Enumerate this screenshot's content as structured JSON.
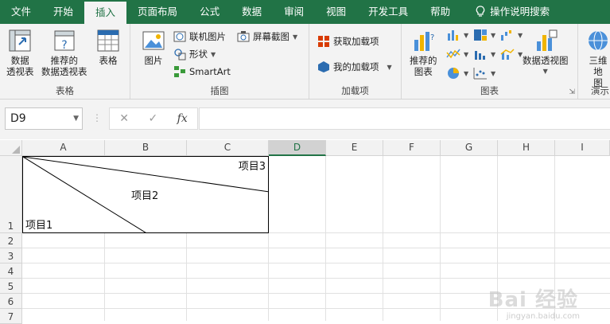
{
  "ribbon_tabs": {
    "file": "文件",
    "home": "开始",
    "insert": "插入",
    "page_layout": "页面布局",
    "formulas": "公式",
    "data": "数据",
    "review": "审阅",
    "view": "视图",
    "developer": "开发工具",
    "help": "帮助",
    "tell_me": "操作说明搜索"
  },
  "groups": {
    "tables": {
      "label": "表格",
      "pivot_line1": "数据",
      "pivot_line2": "透视表",
      "recommended_line1": "推荐的",
      "recommended_line2": "数据透视表",
      "table": "表格"
    },
    "illustrations": {
      "label": "插图",
      "pictures": "图片",
      "online_pictures": "联机图片",
      "shapes": "形状",
      "smartart": "SmartArt",
      "screenshot": "屏幕截图"
    },
    "addins": {
      "label": "加载项",
      "get_addins": "获取加载项",
      "my_addins": "我的加载项"
    },
    "charts": {
      "label": "图表",
      "recommended_line1": "推荐的",
      "recommended_line2": "图表",
      "pivot_chart": "数据透视图"
    },
    "tours": {
      "label": "演示",
      "map_line1": "三维地",
      "map_line2": "图"
    }
  },
  "formula_bar": {
    "name_box": "D9",
    "cancel_symbol": "✕",
    "enter_symbol": "✓",
    "fx_symbol": "fx",
    "formula_value": ""
  },
  "columns": [
    "A",
    "B",
    "C",
    "D",
    "E",
    "F",
    "G",
    "H",
    "I"
  ],
  "rows": [
    "1",
    "2",
    "3",
    "4",
    "5",
    "6",
    "7"
  ],
  "cells": {
    "item1": "项目1",
    "item2": "项目2",
    "item3": "项目3"
  },
  "watermark": {
    "main": "Bai 经验",
    "sub": "jingyan.baidu.com"
  },
  "colors": {
    "accent": "#217346",
    "ribbon_bg": "#f3f3f3"
  }
}
